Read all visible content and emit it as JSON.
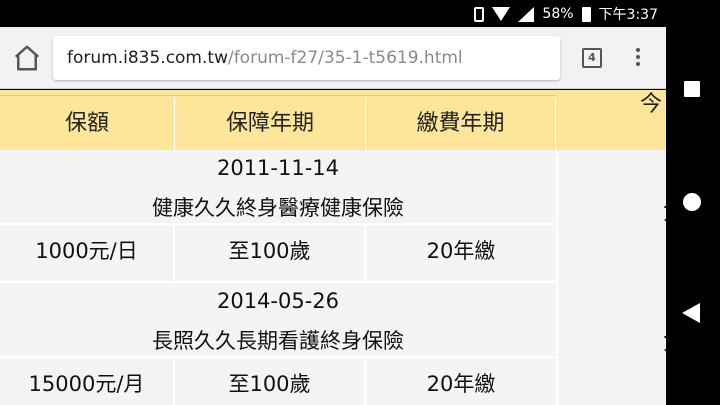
{
  "status_bar": {
    "battery_pct": "58%",
    "time": "下午3:37"
  },
  "browser": {
    "url_host": "forum.i835.com.tw",
    "url_path": "/forum-f27/35-1-t5619.html",
    "tab_count": "4"
  },
  "table": {
    "headers": [
      "保額",
      "保障年期",
      "繳費年期"
    ],
    "cut_header_fragment": "今",
    "records": [
      {
        "date": "2011-11-14",
        "name": "健康久久終身醫療健康保險",
        "coverage": "1000元/日",
        "term": "至100歲",
        "payment": "20年繳",
        "side_fragment": "1"
      },
      {
        "date": "2014-05-26",
        "name": "長照久久長期看護終身保險",
        "coverage": "15000元/月",
        "term": "至100歲",
        "payment": "20年繳",
        "side_fragment": "1"
      }
    ]
  }
}
